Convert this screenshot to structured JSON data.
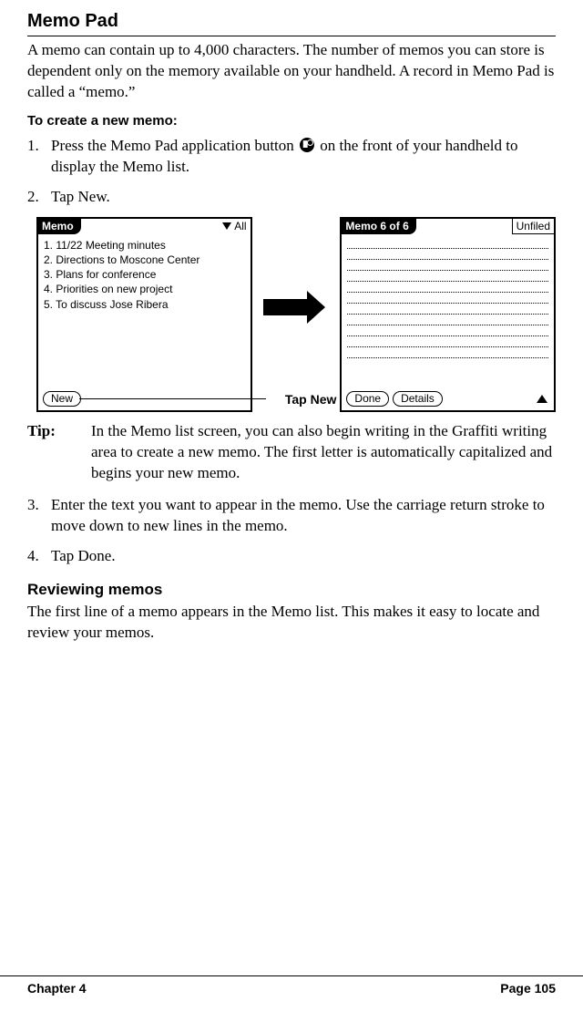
{
  "title": "Memo Pad",
  "intro": "A memo can contain up to 4,000 characters. The number of memos you can store is dependent only on the memory available on your handheld. A record in Memo Pad is called a “memo.”",
  "create_head": "To create a new memo:",
  "steps": {
    "s1a": "Press the Memo Pad application button ",
    "s1b": " on the front of your handheld to display the Memo list.",
    "s2": "Tap New.",
    "s3": "Enter the text you want to appear in the memo. Use the carriage return stroke to move down to new lines in the memo.",
    "s4": "Tap Done."
  },
  "left_screen": {
    "title": "Memo",
    "category": "All",
    "items": [
      "1.  11/22 Meeting minutes",
      "2.  Directions to Moscone Center",
      "3.  Plans for conference",
      "4.  Priorities on new project",
      "5.  To discuss Jose Ribera"
    ],
    "new_btn": "New"
  },
  "right_screen": {
    "title": "Memo 6 of 6",
    "category": "Unfiled",
    "done_btn": "Done",
    "details_btn": "Details"
  },
  "callout": "Tap New",
  "tip_label": "Tip:",
  "tip_text": "In the Memo list screen, you can also begin writing in the Graffiti writing area to create a new memo. The first letter is automatically capitalized and begins your new memo.",
  "review_head": "Reviewing memos",
  "review_text": "The first line of a memo appears in the Memo list. This makes it easy to locate and review your memos.",
  "footer_left": "Chapter 4",
  "footer_right": "Page 105"
}
